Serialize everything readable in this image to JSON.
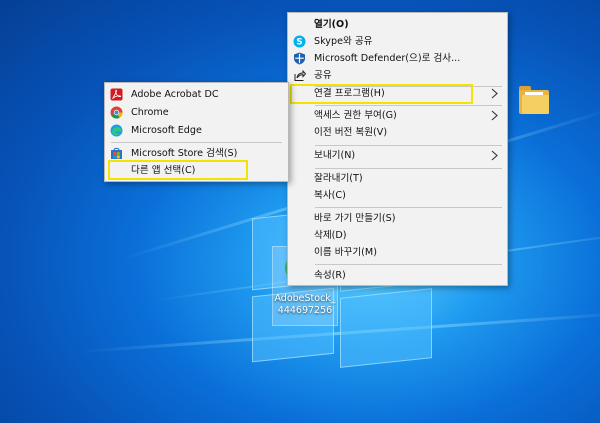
{
  "desktop": {
    "file": {
      "name_line1": "AdobeStock_",
      "name_line2": "444697256"
    }
  },
  "context_menu": {
    "items": [
      {
        "label": "열기(O)",
        "icon": "none",
        "bold": true
      },
      {
        "label": "Skype와 공유",
        "icon": "skype-icon"
      },
      {
        "label": "Microsoft Defender(으)로 검사...",
        "icon": "defender-shield-icon"
      },
      {
        "label": "공유",
        "icon": "share-icon"
      },
      {
        "label": "연결 프로그램(H)",
        "icon": "none",
        "submenu": true
      },
      {
        "label": "액세스 권한 부여(G)",
        "icon": "none",
        "submenu": true
      },
      {
        "label": "이전 버전 복원(V)",
        "icon": "none"
      },
      {
        "label": "보내기(N)",
        "icon": "none",
        "submenu": true
      },
      {
        "label": "잘라내기(T)",
        "icon": "none"
      },
      {
        "label": "복사(C)",
        "icon": "none"
      },
      {
        "label": "바로 가기 만들기(S)",
        "icon": "none"
      },
      {
        "label": "삭제(D)",
        "icon": "none"
      },
      {
        "label": "이름 바꾸기(M)",
        "icon": "none"
      },
      {
        "label": "속성(R)",
        "icon": "none"
      }
    ]
  },
  "open_with_menu": {
    "items": [
      {
        "label": "Adobe Acrobat DC",
        "icon": "acrobat-icon"
      },
      {
        "label": "Chrome",
        "icon": "chrome-icon"
      },
      {
        "label": "Microsoft Edge",
        "icon": "edge-icon"
      },
      {
        "label": "Microsoft Store 검색(S)",
        "icon": "store-icon"
      },
      {
        "label": "다른 앱 선택(C)",
        "icon": "none"
      }
    ]
  },
  "colors": {
    "highlight_box": "#f2e300",
    "menu_background": "#f2f2f2",
    "desktop_blue": "#0a6fd8"
  }
}
